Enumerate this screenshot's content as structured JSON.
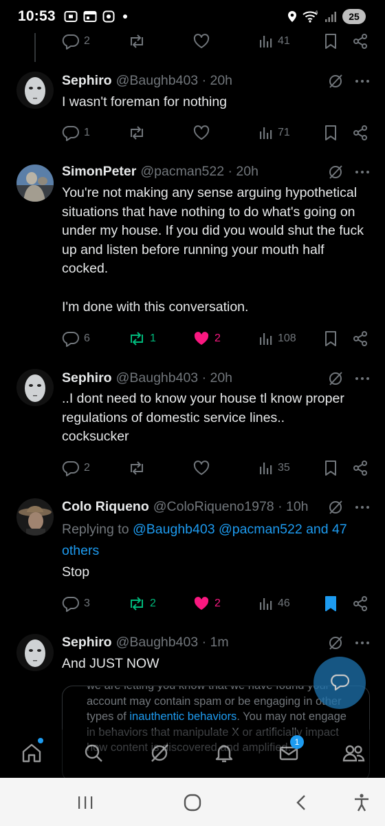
{
  "status_bar": {
    "time": "10:53",
    "battery": "25"
  },
  "colors": {
    "background": "#000000",
    "text": "#e7e9ea",
    "muted": "#71767b",
    "accent": "#1d9bf0",
    "like": "#f91880",
    "repost": "#00ba7c"
  },
  "top_actions": {
    "replies": "2",
    "views": "41"
  },
  "tweets": [
    {
      "name": "Sephiro",
      "meta": "@Baughb403 · 20h",
      "text": "I wasn't foreman for nothing",
      "replies": "1",
      "views": "71"
    },
    {
      "name": "SimonPeter",
      "meta": "@pacman522 · 20h",
      "text": "You're not making any sense arguing hypothetical situations that have nothing to do what's going on under my house. If you did you would shut the fuck up and listen before running your mouth half cocked.\n\nI'm done with this conversation.",
      "replies": "6",
      "reposts": "1",
      "likes": "2",
      "views": "108"
    },
    {
      "name": "Sephiro",
      "meta": "@Baughb403 · 20h",
      "text": "..I dont need to know your house tl know proper regulations of domestic service lines..\ncocksucker",
      "replies": "2",
      "views": "35"
    },
    {
      "name": "Colo Riqueno",
      "meta": "@ColoRiqueno1978 · 10h",
      "replying_prefix": "Replying to ",
      "replying_mentions": "@Baughb403 @pacman522 and 47 others",
      "text": "Stop",
      "replies": "3",
      "reposts": "2",
      "likes": "2",
      "views": "46"
    },
    {
      "name": "Sephiro",
      "meta": "@Baughb403 · 1m",
      "text": "And JUST NOW"
    }
  ],
  "notice": {
    "line1": "we are letting you know that we have found your account may contain spam or be engaging in other types of ",
    "link": "inauthentic behaviors",
    "line2": ". You may not engage in behaviors that manipulate X or artificially impact how content is discovered and amplified."
  },
  "bottom_nav": {
    "notifications_badge": "1"
  },
  "icons": [
    "reply-icon",
    "repost-icon",
    "like-icon",
    "views-icon",
    "bookmark-icon",
    "share-icon",
    "grok-icon",
    "more-icon",
    "home-icon",
    "search-icon",
    "communities-icon",
    "bell-icon",
    "mail-icon",
    "people-icon",
    "compose-icon",
    "recents-icon",
    "home-circle-icon",
    "back-icon",
    "accessibility-icon"
  ]
}
